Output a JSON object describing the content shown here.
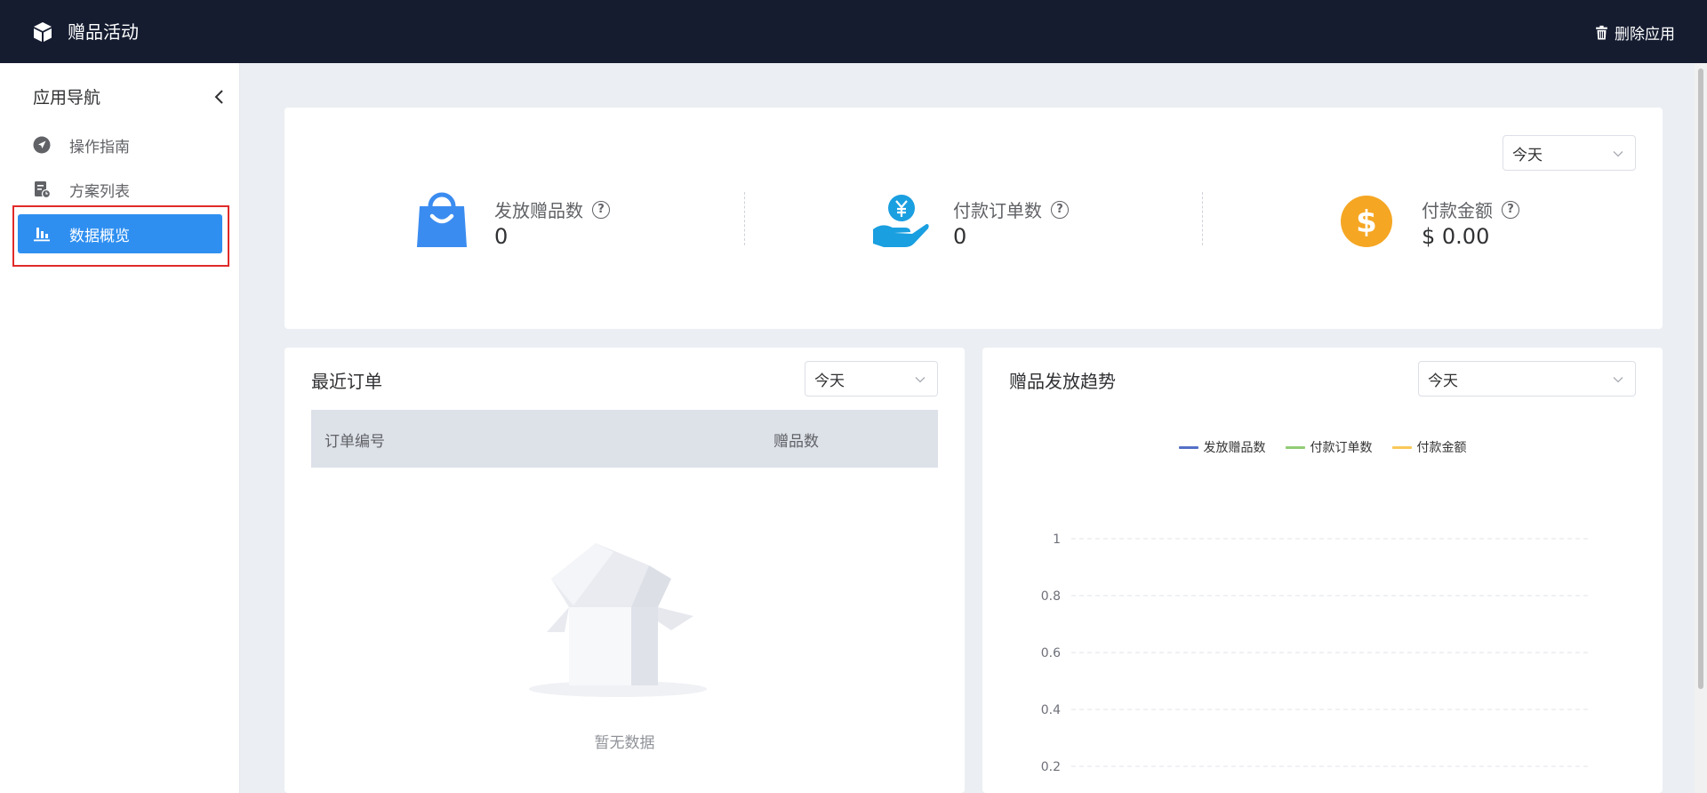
{
  "app": {
    "title": "赠品活动",
    "delete_label": "删除应用"
  },
  "sidebar": {
    "title": "应用导航",
    "items": [
      {
        "label": "操作指南",
        "icon": "navigation-arrow-icon",
        "active": false
      },
      {
        "label": "方案列表",
        "icon": "document-list-icon",
        "active": false
      },
      {
        "label": "数据概览",
        "icon": "bar-chart-icon",
        "active": true
      }
    ]
  },
  "stats": {
    "period": "今天",
    "items": [
      {
        "label": "发放赠品数",
        "value": "0",
        "icon": "shopping-bag-icon",
        "color": "#3b8cf0"
      },
      {
        "label": "付款订单数",
        "value": "0",
        "icon": "hand-yuan-icon",
        "color": "#1a9fe0"
      },
      {
        "label": "付款金额",
        "value": "$ 0.00",
        "icon": "dollar-coin-icon",
        "color": "#f5a623"
      }
    ]
  },
  "orders": {
    "title": "最近订单",
    "period": "今天",
    "columns": [
      "订单编号",
      "赠品数"
    ],
    "rows": [],
    "empty_text": "暂无数据"
  },
  "trend": {
    "title": "赠品发放趋势",
    "period": "今天"
  },
  "chart_data": {
    "type": "line",
    "series": [
      {
        "name": "发放赠品数",
        "color": "#5470c6",
        "values": []
      },
      {
        "name": "付款订单数",
        "color": "#91cc75",
        "values": []
      },
      {
        "name": "付款金额",
        "color": "#fac858",
        "values": []
      }
    ],
    "yticks": [
      "1",
      "0.8",
      "0.6",
      "0.4",
      "0.2"
    ],
    "ylim": [
      0,
      1
    ],
    "grid": true,
    "legend_position": "top-center"
  }
}
